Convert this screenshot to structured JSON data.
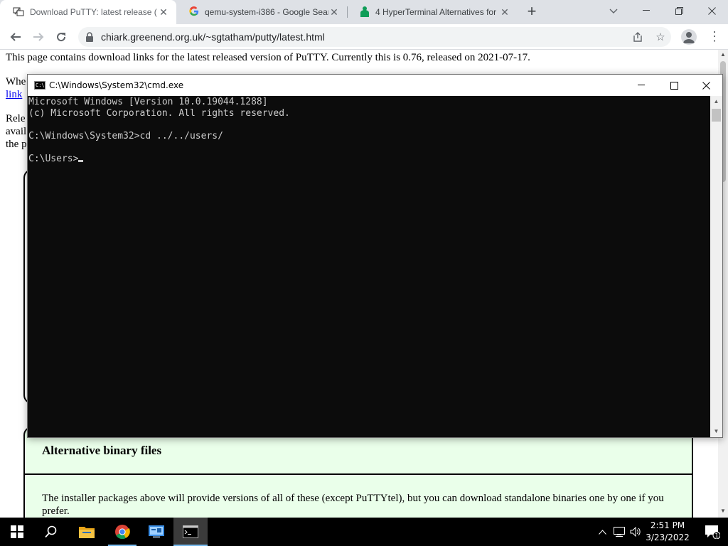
{
  "browser": {
    "tabs": [
      {
        "title": "Download PuTTY: latest release (",
        "icon": "putty-favicon",
        "active": true
      },
      {
        "title": "qemu-system-i386 - Google Sear",
        "icon": "google-favicon",
        "active": false
      },
      {
        "title": "4 HyperTerminal Alternatives for",
        "icon": "site-favicon",
        "active": false
      }
    ],
    "url": "chiark.greenend.org.uk/~sgtatham/putty/latest.html"
  },
  "page": {
    "intro": "This page contains download links for the latest released version of PuTTY. Currently this is 0.76, released on 2021-07-17.",
    "line2_fragment": "Whe",
    "link_fragment": "link",
    "line3_fragment": "Rele",
    "line4_fragment": "avail",
    "line5_fragment": "the p",
    "section_heading": "Alternative binary files",
    "section_body": "The installer packages above will provide versions of all of these (except PuTTYtel), but you can download standalone binaries one by one if you prefer."
  },
  "cmd": {
    "title": "C:\\Windows\\System32\\cmd.exe",
    "lines": [
      "Microsoft Windows [Version 10.0.19044.1288]",
      "(c) Microsoft Corporation. All rights reserved.",
      "",
      "C:\\Windows\\System32>cd ../../users/",
      "",
      "C:\\Users>"
    ]
  },
  "taskbar": {
    "time": "2:51 PM",
    "date": "3/23/2022",
    "notification_count": "1",
    "accent_color": "#76b9ed"
  }
}
